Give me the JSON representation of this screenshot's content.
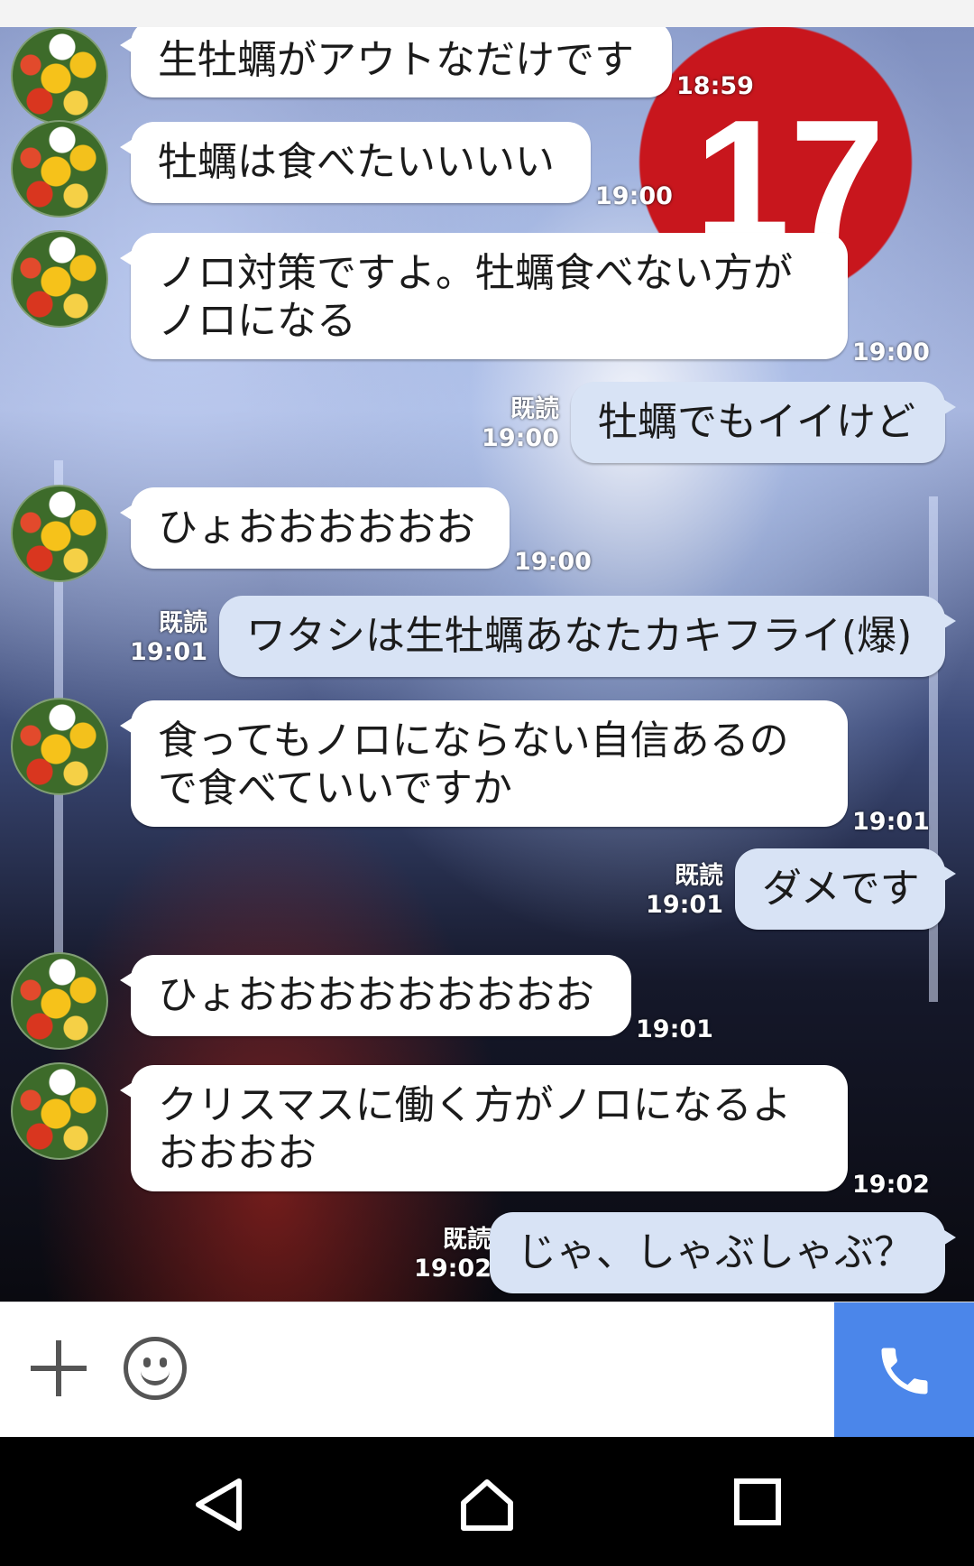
{
  "messages": [
    {
      "side": "in",
      "text": "生牡蠣がアウトなだけです",
      "time": "18:59"
    },
    {
      "side": "in",
      "text": "牡蠣は食べたいいいい",
      "time": "19:00"
    },
    {
      "side": "in",
      "text": "ノロ対策ですよ。牡蠣食べない方が",
      "text2": "ノロになる",
      "time": "19:00"
    },
    {
      "side": "out",
      "text": "牡蠣でもイイけど",
      "read": "既読",
      "time": "19:00"
    },
    {
      "side": "in",
      "text": "ひょおおおおおお",
      "time": "19:00"
    },
    {
      "side": "out",
      "text": "ワタシは生牡蠣あなたカキフライ(爆)",
      "read": "既読",
      "time": "19:01"
    },
    {
      "side": "in",
      "text": "食ってもノロにならない自信あるの",
      "text2": "で食べていいですか",
      "time": "19:01"
    },
    {
      "side": "out",
      "text": "ダメです",
      "read": "既読",
      "time": "19:01"
    },
    {
      "side": "in",
      "text": "ひょおおおおおおおおお",
      "time": "19:01"
    },
    {
      "side": "in",
      "text": "クリスマスに働く方がノロになるよ",
      "text2": "おおおお",
      "time": "19:02"
    },
    {
      "side": "out",
      "text": "じゃ、しゃぶしゃぶ？",
      "read": "既読",
      "time": "19:02"
    }
  ],
  "wallpaper": {
    "seal_number": "17"
  },
  "input_bar": {
    "plus_icon": "plus-icon",
    "emoji_icon": "smiley-icon",
    "call_icon": "phone-icon",
    "accent_color": "#4b86ea"
  },
  "nav": {
    "back_icon": "back-triangle-icon",
    "home_icon": "home-icon",
    "recents_icon": "recents-square-icon"
  }
}
